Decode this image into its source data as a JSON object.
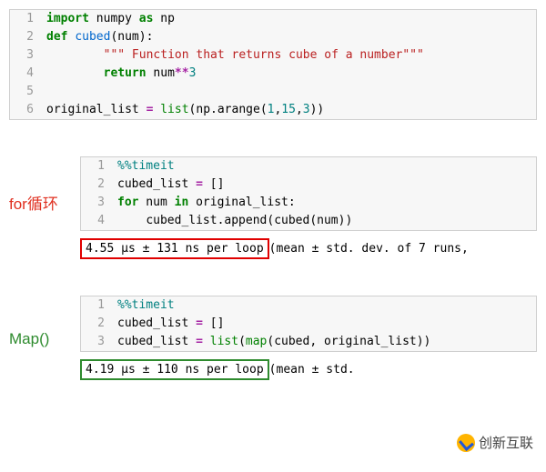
{
  "block1": {
    "lines": [
      1,
      2,
      3,
      4,
      5,
      6
    ],
    "l1_kw": "import",
    "l1_b": " numpy ",
    "l1_as": "as",
    "l1_c": " np",
    "l2_def": "def",
    "l2_sp": " ",
    "l2_fn": "cubed",
    "l2_open": "(num):",
    "l3_indent": "        ",
    "l3_doc": "\"\"\" Function that returns cube of a number\"\"\"",
    "l4_indent": "        ",
    "l4_ret": "return",
    "l4_b": " num",
    "l4_op": "**",
    "l4_n": "3",
    "l5": " ",
    "l6_a": "original_list ",
    "l6_eq": "=",
    "l6_b": " ",
    "l6_list": "list",
    "l6_c": "(np.arange(",
    "l6_n1": "1",
    "l6_d": ",",
    "l6_n2": "15",
    "l6_e": ",",
    "l6_n3": "3",
    "l6_f": "))"
  },
  "section1": {
    "label": "for循环",
    "block": {
      "lines": [
        1,
        2,
        3,
        4
      ],
      "l1_a": "%%",
      "l1_b": "timeit",
      "l2_a": "cubed_list ",
      "l2_eq": "=",
      "l2_b": " []",
      "l3_for": "for",
      "l3_a": " num ",
      "l3_in": "in",
      "l3_b": " original_list:",
      "l4_indent": "    ",
      "l4_a": "cubed_list.append(cubed(num))"
    },
    "result_hl": "4.55 µs ± 131 ns per loop ",
    "result_rest": "(mean ± std. dev. of 7 runs, "
  },
  "section2": {
    "label": "Map()",
    "block": {
      "lines": [
        1,
        2,
        3
      ],
      "l1_a": "%%",
      "l1_b": "timeit",
      "l2_a": "cubed_list ",
      "l2_eq": "=",
      "l2_b": " []",
      "l3_a": "cubed_list ",
      "l3_eq": "=",
      "l3_b": " ",
      "l3_list": "list",
      "l3_c": "(",
      "l3_map": "map",
      "l3_d": "(cubed, original_list))"
    },
    "result_hl": "4.19 µs ± 110 ns per loop ",
    "result_rest": "(mean ± std. "
  },
  "watermark": "创新互联"
}
